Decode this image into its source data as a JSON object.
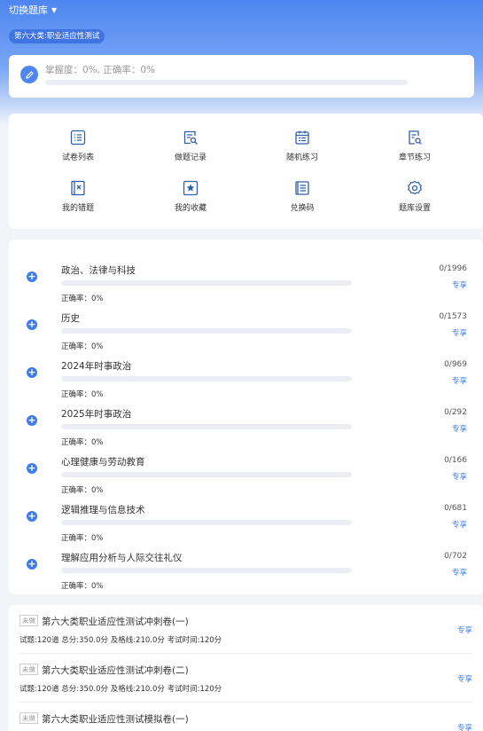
{
  "header": {
    "switch_label": "切换题库",
    "category": "第六大类:职业适应性测试"
  },
  "mastery": {
    "text": "掌握度：0%, 正确率：0%",
    "progress": 0
  },
  "grid": [
    {
      "label": "试卷列表",
      "icon": "list-icon"
    },
    {
      "label": "做题记录",
      "icon": "record-icon"
    },
    {
      "label": "随机练习",
      "icon": "calendar-icon"
    },
    {
      "label": "章节练习",
      "icon": "chapter-search-icon"
    },
    {
      "label": "我的错题",
      "icon": "wrong-book-icon"
    },
    {
      "label": "我的收藏",
      "icon": "star-icon"
    },
    {
      "label": "兑换码",
      "icon": "code-icon"
    },
    {
      "label": "题库设置",
      "icon": "gear-icon"
    }
  ],
  "subjects": [
    {
      "name": "政治、法律与科技",
      "count": "0/1996",
      "accuracy": "正确率：0%",
      "vip": "专享"
    },
    {
      "name": "历史",
      "count": "0/1573",
      "accuracy": "正确率：0%",
      "vip": "专享"
    },
    {
      "name": "2024年时事政治",
      "count": "0/969",
      "accuracy": "正确率：0%",
      "vip": "专享"
    },
    {
      "name": "2025年时事政治",
      "count": "0/292",
      "accuracy": "正确率：0%",
      "vip": "专享"
    },
    {
      "name": "心理健康与劳动教育",
      "count": "0/166",
      "accuracy": "正确率：0%",
      "vip": "专享"
    },
    {
      "name": "逻辑推理与信息技术",
      "count": "0/681",
      "accuracy": "正确率：0%",
      "vip": "专享"
    },
    {
      "name": "理解应用分析与人际交往礼仪",
      "count": "0/702",
      "accuracy": "正确率：0%",
      "vip": "专享"
    }
  ],
  "papers": [
    {
      "badge": "未做",
      "title": "第六大类职业适应性测试冲刺卷(一)",
      "meta": "试题:120道  总分:350.0分  及格线:210.0分  考试时间:120分",
      "vip": "专享"
    },
    {
      "badge": "未做",
      "title": "第六大类职业适应性测试冲刺卷(二)",
      "meta": "试题:120道  总分:350.0分  及格线:210.0分  考试时间:120分",
      "vip": "专享"
    },
    {
      "badge": "未做",
      "title": "第六大类职业适应性测试模拟卷(一)",
      "meta": "",
      "vip": "专享"
    }
  ],
  "colors": {
    "accent": "#3f7ce8",
    "hero_top": "#4d86f0"
  }
}
